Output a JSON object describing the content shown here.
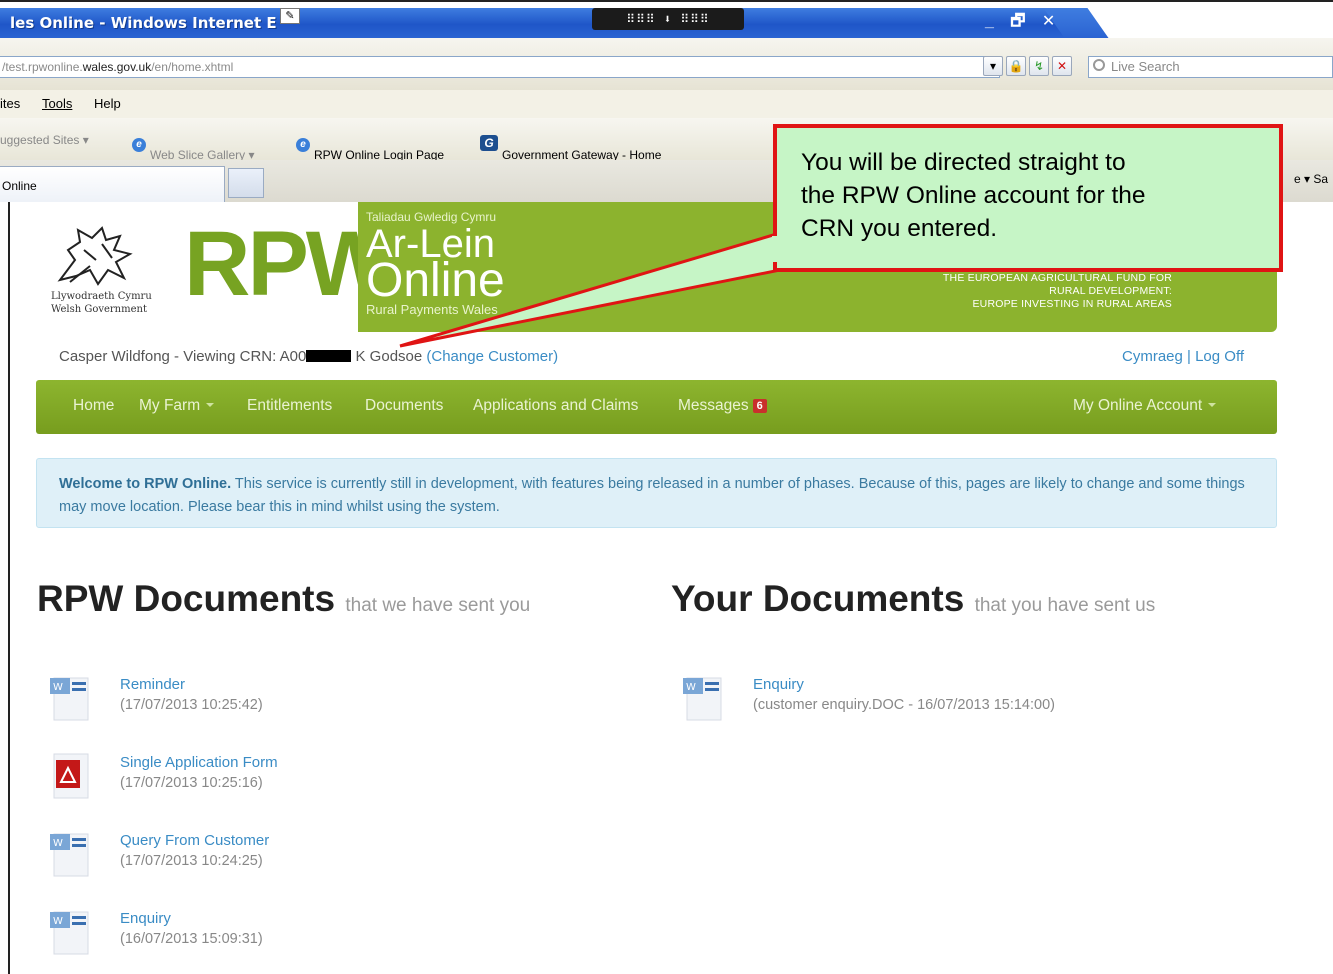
{
  "browser": {
    "window_title": "les Online - Windows Internet E",
    "window_controls": "_ 🗗 ✕",
    "address_prefix": "/test.rpwonline.",
    "address_domain": "wales.gov.uk",
    "address_suffix": "/en/home.xhtml",
    "search_placeholder": "Live Search",
    "menu": [
      "ites",
      "Tools",
      "Help"
    ],
    "favorites": [
      "uggested Sites ▾",
      "Web Slice Gallery ▾",
      "RPW Online Login Page",
      "Government Gateway - Home"
    ],
    "favorites_right": "e ▾  Sa",
    "tab_label": "Online"
  },
  "header": {
    "logo_text_line1": "Llywodraeth Cymru",
    "logo_text_line2": "Welsh Government",
    "brand": "RPW",
    "banner_sub": "Taliadau Gwledig Cymru",
    "banner_ar": "Ar-Lein",
    "banner_online": "Online",
    "banner_rp": "Rural Payments Wales",
    "eu_line1": "THE EUROPEAN AGRICULTURAL FUND FOR",
    "eu_line2": "RURAL DEVELOPMENT:",
    "eu_line3": "EUROPE INVESTING IN RURAL AREAS"
  },
  "user": {
    "prefix": "Casper Wildfong - Viewing CRN: A00",
    "suffix": " K Godsoe ",
    "change_customer": "(Change Customer)",
    "cymraeg": "Cymraeg",
    "separator": " | ",
    "logoff": "Log Off"
  },
  "nav": {
    "home": "Home",
    "my_farm": "My Farm",
    "entitlements": "Entitlements",
    "documents": "Documents",
    "applications": "Applications and Claims",
    "messages": "Messages",
    "messages_count": "6",
    "my_account": "My Online Account"
  },
  "alert": {
    "bold": "Welcome to RPW Online.",
    "text": " This service is currently still in development, with features being released in a number of phases. Because of this, pages are likely to change and some things may move location. Please bear this in mind whilst using the system."
  },
  "rpw_docs": {
    "title": "RPW Documents",
    "subtitle": "that we have sent you",
    "items": [
      {
        "name": "Reminder",
        "date": "(17/07/2013 10:25:42)",
        "icon": "word-doc-icon"
      },
      {
        "name": "Single Application Form",
        "date": "(17/07/2013 10:25:16)",
        "icon": "pdf-icon"
      },
      {
        "name": "Query From Customer",
        "date": "(17/07/2013 10:24:25)",
        "icon": "word-doc-icon"
      },
      {
        "name": "Enquiry",
        "date": "(16/07/2013 15:09:31)",
        "icon": "word-doc-icon"
      }
    ]
  },
  "your_docs": {
    "title": "Your Documents",
    "subtitle": "that you have sent us",
    "items": [
      {
        "name": "Enquiry",
        "date": "(customer enquiry.DOC - 16/07/2013 15:14:00)",
        "icon": "word-doc-icon"
      }
    ]
  },
  "callout": {
    "line1": "You will be directed straight to",
    "line2": "the RPW Online account for the",
    "line3": "CRN you entered."
  },
  "colors": {
    "brand_green": "#8cb32e",
    "link_blue": "#3a8cc5",
    "callout_border": "#e01414",
    "callout_fill": "#c6f5c6"
  }
}
